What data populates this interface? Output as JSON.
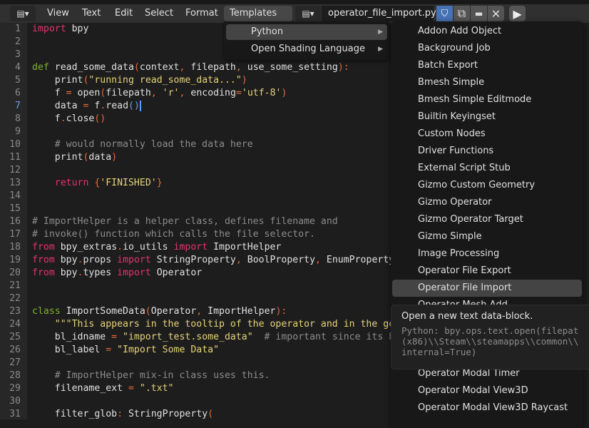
{
  "header": {
    "editor_type_icon": "text-editor-icon",
    "menus": [
      "View",
      "Text",
      "Edit",
      "Select",
      "Format",
      "Templates"
    ],
    "active_menu": "Templates",
    "filename": "operator_file_import.py",
    "icons": [
      "shield-check-icon",
      "duplicate-icon",
      "folder-open-icon",
      "close-icon",
      "play-icon"
    ],
    "accent": "#4772b3"
  },
  "templates_menu": {
    "items": [
      {
        "label": "Python",
        "submenu": true,
        "highlighted": true
      },
      {
        "label": "Open Shading Language",
        "submenu": true
      }
    ]
  },
  "python_submenu": {
    "items": [
      "Addon Add Object",
      "Background Job",
      "Batch Export",
      "Bmesh Simple",
      "Bmesh Simple Editmode",
      "Builtin Keyingset",
      "Custom Nodes",
      "Driver Functions",
      "External Script Stub",
      "Gizmo Custom Geometry",
      "Gizmo Operator",
      "Gizmo Operator Target",
      "Gizmo Simple",
      "Image Processing",
      "Operator File Export",
      "Operator File Import",
      "Operator Mesh Add",
      "Operator Modal Timer",
      "Operator Modal View3D",
      "Operator Modal View3D Raycast"
    ],
    "highlighted": "Operator File Import"
  },
  "tooltip": {
    "title": "Open a new text data-block.",
    "python": "Python: bpy.ops.text.open(filepat\n(x86)\\\\Steam\\\\steamapps\\\\common\\\\\ninternal=True)"
  },
  "editor": {
    "current_line": 7,
    "lines": [
      [
        [
          "kw",
          "import"
        ],
        [
          "t",
          " bpy"
        ]
      ],
      [],
      [],
      [
        [
          "df",
          "def"
        ],
        [
          "t",
          " read_some_data"
        ],
        [
          "op",
          "("
        ],
        [
          "t",
          "context"
        ],
        [
          "op",
          ","
        ],
        [
          "t",
          " filepath"
        ],
        [
          "op",
          ","
        ],
        [
          "t",
          " use_some_setting"
        ],
        [
          "op",
          "):"
        ]
      ],
      [
        [
          "t",
          "    print"
        ],
        [
          "op",
          "("
        ],
        [
          "st",
          "\"running read_some_data...\""
        ],
        [
          "op",
          ")"
        ]
      ],
      [
        [
          "t",
          "    f "
        ],
        [
          "op",
          "="
        ],
        [
          "t",
          " open"
        ],
        [
          "op",
          "("
        ],
        [
          "t",
          "filepath"
        ],
        [
          "op",
          ","
        ],
        [
          "st",
          " 'r'"
        ],
        [
          "op",
          ","
        ],
        [
          "t",
          " encoding"
        ],
        [
          "op",
          "="
        ],
        [
          "st",
          "'utf-8'"
        ],
        [
          "op",
          ")"
        ]
      ],
      [
        [
          "t",
          "    data "
        ],
        [
          "op",
          "="
        ],
        [
          "t",
          " f"
        ],
        [
          "op",
          "."
        ],
        [
          "t",
          "read"
        ],
        [
          "cb",
          "()"
        ],
        [
          "caret",
          ""
        ]
      ],
      [
        [
          "t",
          "    f"
        ],
        [
          "op",
          "."
        ],
        [
          "t",
          "close"
        ],
        [
          "op",
          "()"
        ]
      ],
      [],
      [
        [
          "cm",
          "    # would normally load the data here"
        ]
      ],
      [
        [
          "t",
          "    print"
        ],
        [
          "op",
          "("
        ],
        [
          "t",
          "data"
        ],
        [
          "op",
          ")"
        ]
      ],
      [],
      [
        [
          "kw",
          "    return"
        ],
        [
          "op",
          " {"
        ],
        [
          "st",
          "'FINISHED'"
        ],
        [
          "op",
          "}"
        ]
      ],
      [],
      [],
      [
        [
          "cm",
          "# ImportHelper is a helper class, defines filename and"
        ]
      ],
      [
        [
          "cm",
          "# invoke() function which calls the file selector."
        ]
      ],
      [
        [
          "kw",
          "from"
        ],
        [
          "t",
          " bpy_extras"
        ],
        [
          "op",
          "."
        ],
        [
          "t",
          "io_utils "
        ],
        [
          "kw",
          "import"
        ],
        [
          "t",
          " ImportHelper"
        ]
      ],
      [
        [
          "kw",
          "from"
        ],
        [
          "t",
          " bpy"
        ],
        [
          "op",
          "."
        ],
        [
          "t",
          "props "
        ],
        [
          "kw",
          "import"
        ],
        [
          "t",
          " StringProperty"
        ],
        [
          "op",
          ","
        ],
        [
          "t",
          " BoolProperty"
        ],
        [
          "op",
          ","
        ],
        [
          "t",
          " EnumProperty"
        ]
      ],
      [
        [
          "kw",
          "from"
        ],
        [
          "t",
          " bpy"
        ],
        [
          "op",
          "."
        ],
        [
          "t",
          "types "
        ],
        [
          "kw",
          "import"
        ],
        [
          "t",
          " Operator"
        ]
      ],
      [],
      [],
      [
        [
          "df",
          "class"
        ],
        [
          "t",
          " ImportSomeData"
        ],
        [
          "op",
          "("
        ],
        [
          "t",
          "Operator"
        ],
        [
          "op",
          ","
        ],
        [
          "t",
          " ImportHelper"
        ],
        [
          "op",
          "):"
        ]
      ],
      [
        [
          "st",
          "    \"\"\"This appears in the tooltip of the operator and in the generated docs"
        ]
      ],
      [
        [
          "t",
          "    bl_idname "
        ],
        [
          "op",
          "="
        ],
        [
          "st",
          " \"import_test.some_data\""
        ],
        [
          "cm",
          "  # important since its how"
        ]
      ],
      [
        [
          "t",
          "    bl_label "
        ],
        [
          "op",
          "="
        ],
        [
          "st",
          " \"Import Some Data\""
        ]
      ],
      [],
      [
        [
          "cm",
          "    # ImportHelper mix-in class uses this."
        ]
      ],
      [
        [
          "t",
          "    filename_ext "
        ],
        [
          "op",
          "="
        ],
        [
          "st",
          " \".txt\""
        ]
      ],
      [],
      [
        [
          "t",
          "    filter_glob"
        ],
        [
          "op",
          ":"
        ],
        [
          "t",
          " StringProperty"
        ],
        [
          "op",
          "("
        ]
      ]
    ]
  }
}
